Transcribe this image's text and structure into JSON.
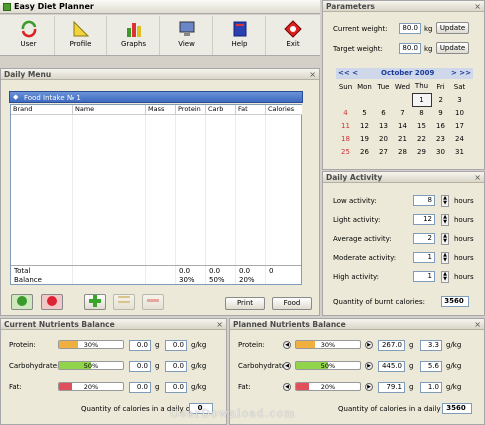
{
  "app": {
    "title": "Easy Diet Planner"
  },
  "toolbar": [
    {
      "label": "User",
      "icon": "user-cycle-icon"
    },
    {
      "label": "Profile",
      "icon": "ruler-triangle-icon"
    },
    {
      "label": "Graphs",
      "icon": "bar-chart-icon"
    },
    {
      "label": "View",
      "icon": "monitor-icon"
    },
    {
      "label": "Help",
      "icon": "book-icon"
    },
    {
      "label": "Exit",
      "icon": "exit-icon"
    }
  ],
  "parameters": {
    "header": "Parameters",
    "current_weight_label": "Current weight:",
    "current_weight": "80.0",
    "unit": "kg",
    "update": "Update",
    "target_weight_label": "Target weight:",
    "target_weight": "80.0"
  },
  "calendar": {
    "nav_prev": "<< <",
    "nav_next": "> >>",
    "month": "October 2009",
    "days": [
      "Sun",
      "Mon",
      "Tue",
      "Wed",
      "Thu",
      "Fri",
      "Sat"
    ],
    "weeks": [
      [
        "",
        "",
        "",
        "",
        "1",
        "2",
        "3"
      ],
      [
        "4",
        "5",
        "6",
        "7",
        "8",
        "9",
        "10"
      ],
      [
        "11",
        "12",
        "13",
        "14",
        "15",
        "16",
        "17"
      ],
      [
        "18",
        "19",
        "20",
        "21",
        "22",
        "23",
        "24"
      ],
      [
        "25",
        "26",
        "27",
        "28",
        "29",
        "30",
        "31"
      ]
    ],
    "selected": "1"
  },
  "daily_menu": {
    "header": "Daily Menu",
    "intake_title": "Food Intake № 1",
    "columns": [
      "Brand",
      "Name",
      "Mass",
      "Protein",
      "Carb",
      "Fat",
      "Calories"
    ],
    "total_label": "Total",
    "balance_label": "Balance",
    "total": [
      "0.0",
      "0.0",
      "0.0",
      "0"
    ],
    "balance": [
      "30%",
      "50%",
      "20%"
    ],
    "print": "Print",
    "food": "Food"
  },
  "daily_activity": {
    "header": "Daily Activity",
    "unit": "hours",
    "rows": [
      {
        "label": "Low activity:",
        "value": "8"
      },
      {
        "label": "Light activity:",
        "value": "12"
      },
      {
        "label": "Average activity:",
        "value": "2"
      },
      {
        "label": "Moderate activity:",
        "value": "1"
      },
      {
        "label": "High activity:",
        "value": "1"
      }
    ],
    "burnt_label": "Quantity of burnt calories:",
    "burnt_value": "3560"
  },
  "current_balance": {
    "header": "Current Nutrients Balance",
    "rows": [
      {
        "label": "Protein:",
        "pct": "30%",
        "fill": 0.3,
        "color": "#f0b040",
        "g": "0.0",
        "gkg": "0.0"
      },
      {
        "label": "Carbohydrate:",
        "pct": "50%",
        "fill": 0.5,
        "color": "#8fd44a",
        "g": "0.0",
        "gkg": "0.0"
      },
      {
        "label": "Fat:",
        "pct": "20%",
        "fill": 0.2,
        "color": "#e0505a",
        "g": "0.0",
        "gkg": "0.0"
      }
    ],
    "g_unit": "g",
    "gkg_unit": "g/kg",
    "calories_label": "Quantity of calories in a daily diet:",
    "calories_value": "0"
  },
  "planned_balance": {
    "header": "Planned Nutrients Balance",
    "rows": [
      {
        "label": "Protein:",
        "pct": "30%",
        "fill": 0.3,
        "color": "#f0b040",
        "g": "267.0",
        "gkg": "3.3"
      },
      {
        "label": "Carbohydrate:",
        "pct": "50%",
        "fill": 0.5,
        "color": "#8fd44a",
        "g": "445.0",
        "gkg": "5.6"
      },
      {
        "label": "Fat:",
        "pct": "20%",
        "fill": 0.2,
        "color": "#e0505a",
        "g": "79.1",
        "gkg": "1.0"
      }
    ],
    "g_unit": "g",
    "gkg_unit": "g/kg",
    "calories_label": "Quantity of calories in a daily diet:",
    "calories_value": "3560"
  },
  "watermark": "GearDownload.com"
}
